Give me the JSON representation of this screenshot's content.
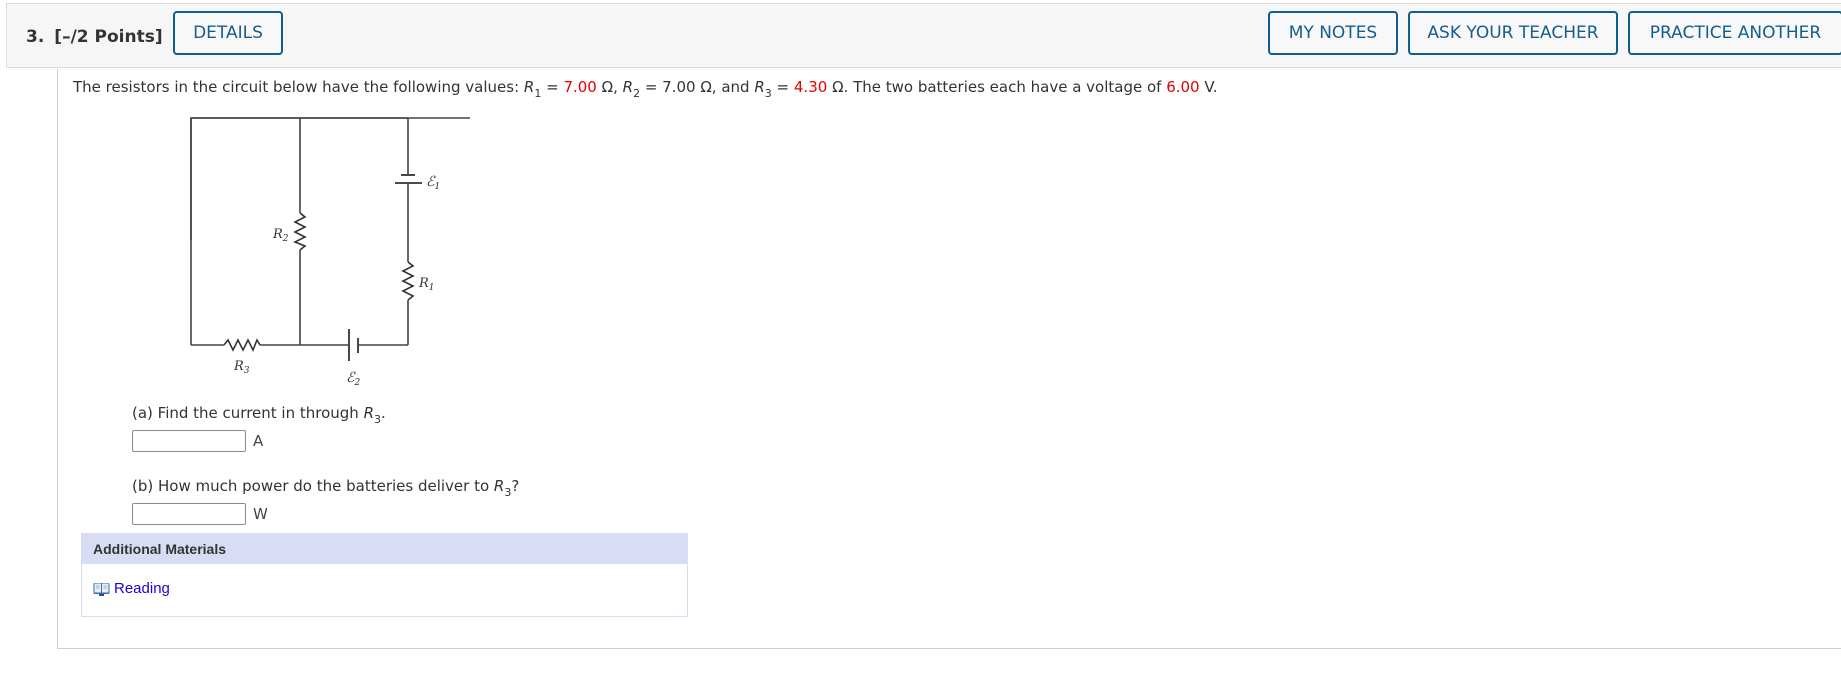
{
  "header": {
    "question_number": "3.",
    "points": "[–/2 Points]",
    "buttons": {
      "details": "DETAILS",
      "my_notes": "MY NOTES",
      "ask_teacher": "ASK YOUR TEACHER",
      "practice_another": "PRACTICE ANOTHER"
    }
  },
  "prompt": {
    "intro": "The resistors in the circuit below have the following values: ",
    "r1_var": "R",
    "r1_sub": "1",
    "r1_eq": " = ",
    "r1_value": "7.00",
    "r1_unit": " Ω, ",
    "r2_var": "R",
    "r2_sub": "2",
    "r2_eq": " = ",
    "r2_value": "7.00",
    "r2_unit": " Ω, and ",
    "r3_var": "R",
    "r3_sub": "3",
    "r3_eq": " = ",
    "r3_value": "4.30",
    "r3_unit": " Ω. The two batteries each have a voltage of ",
    "voltage_value": "6.00",
    "voltage_unit": " V."
  },
  "colors": {
    "highlight": "#e60000",
    "button_border": "#0e5e92",
    "additional_header_bg": "#d8ddf5",
    "link": "#2200cc"
  },
  "circuit": {
    "labels": {
      "emf1": "ℰ",
      "emf1_sub": "1",
      "emf2": "ℰ",
      "emf2_sub": "2",
      "r1": "R",
      "r1_sub": "1",
      "r2": "R",
      "r2_sub": "2",
      "r3": "R",
      "r3_sub": "3"
    }
  },
  "parts": [
    {
      "label": "(a) Find the current in through ",
      "var": "R",
      "sub": "3",
      "end": ".",
      "answer_value": "",
      "unit": "A"
    },
    {
      "label": "(b) How much power do the batteries deliver to ",
      "var": "R",
      "sub": "3",
      "end": "?",
      "answer_value": "",
      "unit": "W"
    }
  ],
  "additional_materials": {
    "title": "Additional Materials",
    "items": [
      {
        "icon": "book-icon",
        "label": "Reading"
      }
    ]
  }
}
